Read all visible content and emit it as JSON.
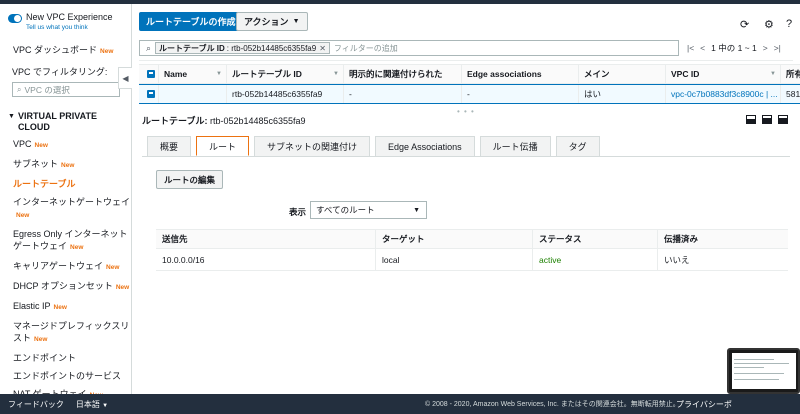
{
  "sidebar": {
    "experience_title": "New VPC Experience",
    "experience_link": "Tell us what you think",
    "dashboard": "VPC ダッシュボード",
    "new_badge": "New",
    "filter_label": "VPC でフィルタリング:",
    "vpc_select_placeholder": "VPC の選択",
    "section_title": "VIRTUAL PRIVATE CLOUD",
    "items": [
      {
        "label": "VPC",
        "new": true
      },
      {
        "label": "サブネット",
        "new": true
      },
      {
        "label": "ルートテーブル",
        "new": false
      },
      {
        "label": "インターネットゲートウェイ",
        "new": true
      },
      {
        "label": "Egress Only インターネットゲートウェイ",
        "new": true
      },
      {
        "label": "キャリアゲートウェイ",
        "new": true
      },
      {
        "label": "DHCP オプションセット",
        "new": true
      },
      {
        "label": "Elastic IP",
        "new": true
      },
      {
        "label": "マネージドプレフィックスリスト",
        "new": true
      },
      {
        "label": "エンドポイント",
        "new": false
      },
      {
        "label": "エンドポイントのサービス",
        "new": false
      },
      {
        "label": "NAT ゲートウェイ",
        "new": true
      }
    ]
  },
  "toolbar": {
    "create_button": "ルートテーブルの作成",
    "actions_button": "アクション"
  },
  "search": {
    "chip_key": "ルートテーブル ID",
    "chip_value": ": rtb-052b14485c6355fa9",
    "placeholder": "フィルターの追加",
    "pager_text": "1 中の 1 ~ 1"
  },
  "table": {
    "headers": [
      "Name",
      "ルートテーブル ID",
      "明示的に関連付けられた",
      "Edge associations",
      "メイン",
      "VPC ID",
      "所有"
    ],
    "row": {
      "name": "",
      "route_table_id": "rtb-052b14485c6355fa9",
      "explicit": "-",
      "edge": "-",
      "main": "はい",
      "vpc_id": "vpc-0c7b0883df3c8900c | ...",
      "owner": "581"
    }
  },
  "detail": {
    "title_label": "ルートテーブル:",
    "title_value": "rtb-052b14485c6355fa9",
    "tabs": [
      "概要",
      "ルート",
      "サブネットの関連付け",
      "Edge Associations",
      "ルート伝播",
      "タグ"
    ],
    "active_tab": "ルート",
    "edit_button": "ルートの編集",
    "view_label": "表示",
    "view_value": "すべてのルート",
    "routes_headers": [
      "送信先",
      "ターゲット",
      "ステータス",
      "伝播済み"
    ],
    "routes": [
      {
        "destination": "10.0.0.0/16",
        "target": "local",
        "status": "active",
        "propagated": "いいえ"
      }
    ]
  },
  "footer": {
    "feedback": "フィードバック",
    "language": "日本語",
    "copyright": "© 2008 - 2020, Amazon Web Services, Inc. またはその関連会社。無断転用禁止。",
    "privacy": "プライバシーポ"
  },
  "colors": {
    "primary": "#0073bb",
    "accent": "#ec7211",
    "active_status": "#1d8102",
    "footer_bg": "#232f3e"
  }
}
